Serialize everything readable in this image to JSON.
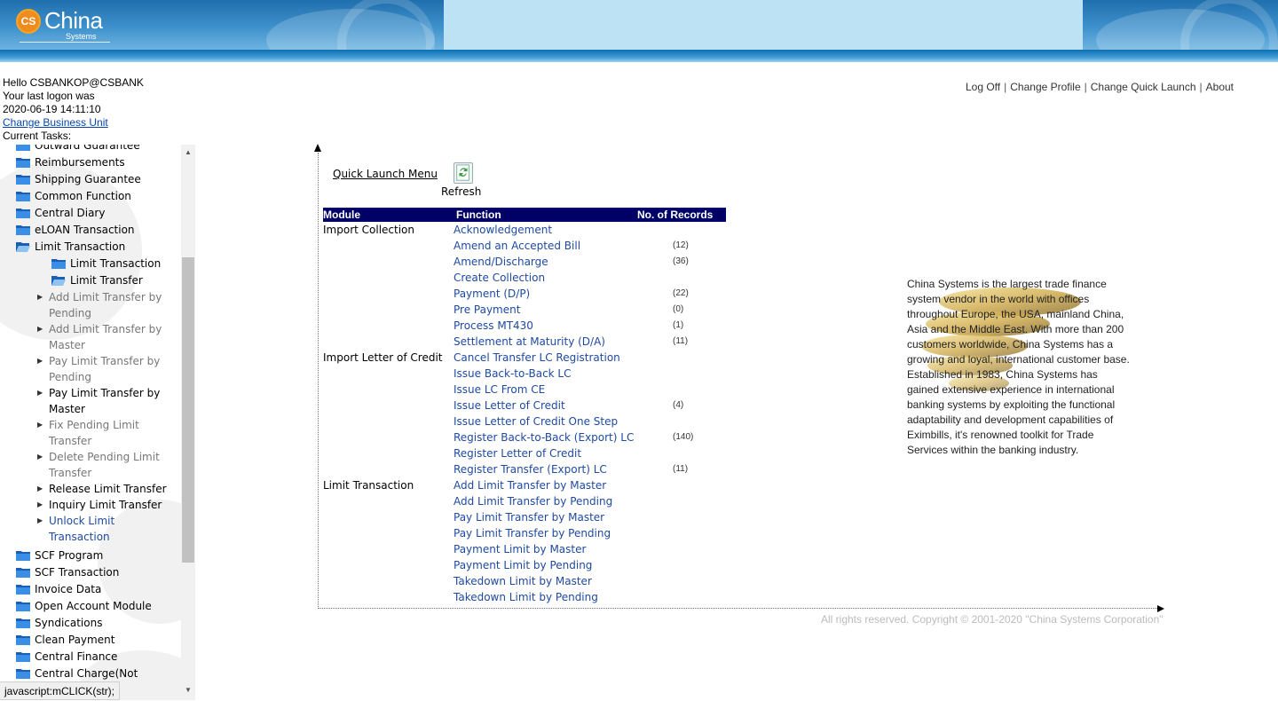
{
  "header": {
    "logo_badge": "CS",
    "logo_name": "China",
    "logo_sub": "Systems"
  },
  "user": {
    "greeting": "Hello CSBANKOP@CSBANK",
    "last_logon_label": "Your last logon was",
    "last_logon_time": "2020-06-19 14:11:10",
    "change_bu_link": "Change Business Unit",
    "current_tasks_label": "Current Tasks:"
  },
  "top_links": {
    "log_off": "Log Off",
    "change_profile": "Change Profile",
    "change_quick_launch": "Change Quick Launch",
    "about": "About",
    "separator": "|"
  },
  "tree": {
    "top_items": [
      "Outward Guarantee",
      "Reimbursements",
      "Shipping Guarantee",
      "Common Function",
      "Central Diary",
      "eLOAN Transaction",
      "Limit Transaction"
    ],
    "sub_folders": [
      "Limit Transaction",
      "Limit Transfer"
    ],
    "leaves": [
      {
        "line1": "Add Limit Transfer by",
        "line2": "Pending"
      },
      {
        "line1": "Add Limit Transfer by",
        "line2": "Master"
      },
      {
        "line1": "Pay Limit Transfer by",
        "line2": "Pending"
      },
      {
        "line1": "Pay Limit Transfer by",
        "line2": "Master"
      },
      {
        "line1": "Fix Pending Limit",
        "line2": "Transfer"
      },
      {
        "line1": "Delete Pending Limit",
        "line2": "Transfer"
      },
      {
        "line1": "Release Limit Transfer",
        "line2": ""
      },
      {
        "line1": "Inquiry Limit Transfer",
        "line2": ""
      },
      {
        "line1": "Unlock Limit",
        "line2": "Transaction"
      }
    ],
    "bottom_items": [
      "SCF Program",
      "SCF Transaction",
      "Invoice Data",
      "Open Account Module",
      "Syndications",
      "Clean Payment",
      "Central Finance",
      "Central Charge(Not"
    ]
  },
  "status_bar": "javascript:mCLICK(str);",
  "quick_launch": {
    "menu_link": "Quick Launch Menu",
    "refresh_label": "Refresh",
    "headers": {
      "module": "Module",
      "function": "Function",
      "records": "No. of Records"
    },
    "rows": [
      {
        "module": "Import Collection",
        "function": "Acknowledgement",
        "count": ""
      },
      {
        "module": "",
        "function": "Amend an Accepted Bill",
        "count": "(12)"
      },
      {
        "module": "",
        "function": "Amend/Discharge",
        "count": "(36)"
      },
      {
        "module": "",
        "function": "Create Collection",
        "count": ""
      },
      {
        "module": "",
        "function": "Payment (D/P)",
        "count": "(22)"
      },
      {
        "module": "",
        "function": "Pre Payment",
        "count": "(0)"
      },
      {
        "module": "",
        "function": "Process MT430",
        "count": "(1)"
      },
      {
        "module": "",
        "function": "Settlement at Maturity (D/A)",
        "count": "(11)"
      },
      {
        "module": "Import Letter of Credit",
        "function": "Cancel Transfer LC Registration",
        "count": ""
      },
      {
        "module": "",
        "function": "Issue Back-to-Back LC",
        "count": ""
      },
      {
        "module": "",
        "function": "Issue LC From CE",
        "count": ""
      },
      {
        "module": "",
        "function": "Issue Letter of Credit",
        "count": "(4)"
      },
      {
        "module": "",
        "function": "Issue Letter of Credit One Step",
        "count": ""
      },
      {
        "module": "",
        "function": "Register Back-to-Back (Export) LC",
        "count": "(140)"
      },
      {
        "module": "",
        "function": "Register Letter of Credit",
        "count": ""
      },
      {
        "module": "",
        "function": "Register Transfer (Export) LC",
        "count": "(11)"
      },
      {
        "module": "Limit Transaction",
        "function": "Add Limit Transfer by Master",
        "count": ""
      },
      {
        "module": "",
        "function": "Add Limit Transfer by Pending",
        "count": ""
      },
      {
        "module": "",
        "function": "Pay Limit Transfer by Master",
        "count": ""
      },
      {
        "module": "",
        "function": "Pay Limit Transfer by Pending",
        "count": ""
      },
      {
        "module": "",
        "function": "Payment Limit by Master",
        "count": ""
      },
      {
        "module": "",
        "function": "Payment Limit by Pending",
        "count": ""
      },
      {
        "module": "",
        "function": "Takedown Limit by Master",
        "count": ""
      },
      {
        "module": "",
        "function": "Takedown Limit by Pending",
        "count": ""
      }
    ]
  },
  "company_info": {
    "paragraph1": "China Systems is the largest trade finance system vendor in the world with offices throughout Europe, the USA, mainland China, Asia and the Middle East. With more than 200 customers worldwide, China Systems has a growing and loyal, international customer base.",
    "paragraph2": "Established in 1983, China Systems has gained extensive experience in international banking systems by exploiting the functional adaptability and development capabilities of Eximbills, it's renowned toolkit for Trade Services within the banking industry."
  },
  "copyright": "All rights reserved. Copyright © 2001-2020 \"China Systems Corporation\"",
  "colors": {
    "grid_header_bg": "#000066",
    "link_blue": "#1f4aa0",
    "banner_blue": "#1f6fae",
    "banner_light": "#bde2f4"
  }
}
